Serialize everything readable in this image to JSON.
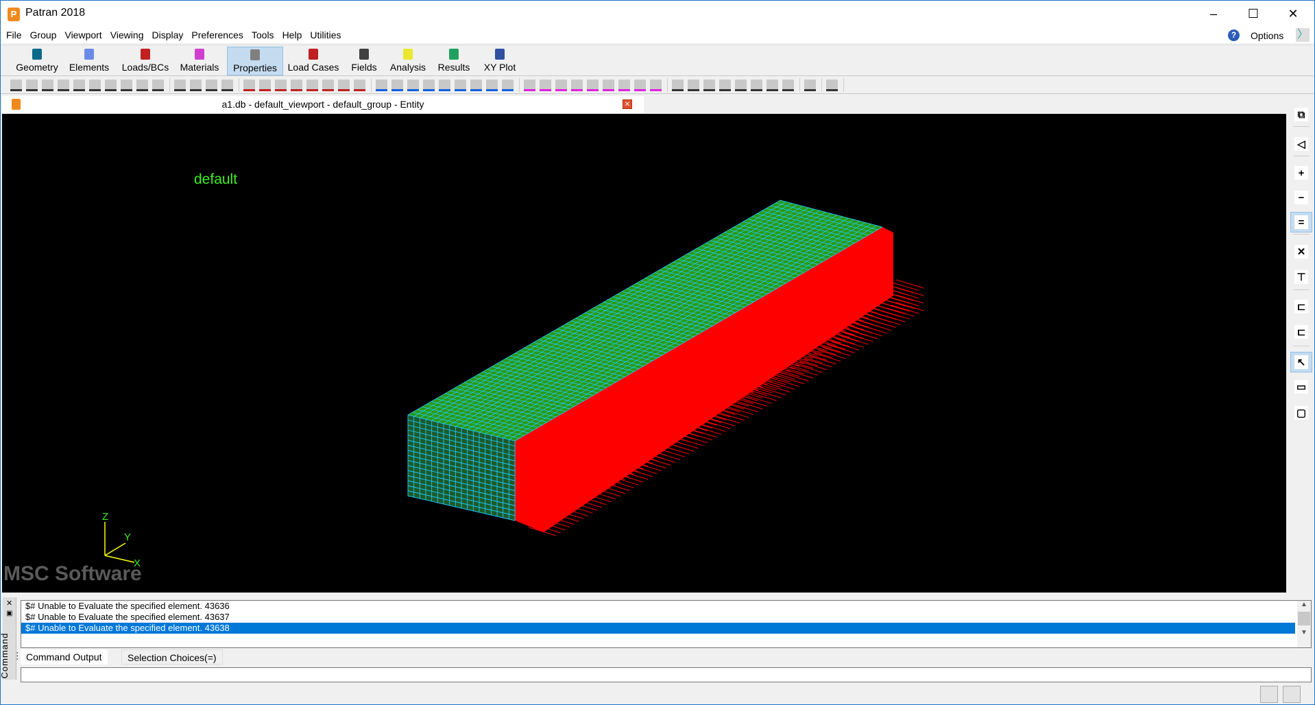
{
  "window": {
    "title": "Patran 2018",
    "minimize": "–",
    "maximize": "☐",
    "close": "✕"
  },
  "menu": [
    "File",
    "Group",
    "Viewport",
    "Viewing",
    "Display",
    "Preferences",
    "Tools",
    "Help",
    "Utilities"
  ],
  "options_label": "Options",
  "help_icon": "?",
  "app_toolbar": [
    {
      "label": "Geometry",
      "color": "#0a6a8a"
    },
    {
      "label": "Elements",
      "color": "#6a8ae8"
    },
    {
      "label": "Loads/BCs",
      "color": "#c02020"
    },
    {
      "label": "Materials",
      "color": "#d040d0"
    },
    {
      "label": "Properties",
      "color": "#808080",
      "active": true
    },
    {
      "label": "Load Cases",
      "color": "#c02020"
    },
    {
      "label": "Fields",
      "color": "#404040"
    },
    {
      "label": "Analysis",
      "color": "#e8e830"
    },
    {
      "label": "Results",
      "color": "#20a060"
    },
    {
      "label": "XY Plot",
      "color": "#3050a0"
    }
  ],
  "icon_toolbar": [
    [
      "new-file",
      "open-file",
      "open-db",
      "save",
      "print",
      "copy",
      "undo",
      "pan-hand",
      "broom",
      "spider"
    ],
    [
      "refresh-1",
      "refresh-2",
      "refresh-3",
      "refresh-4"
    ],
    [
      "fit-view",
      "move",
      "center",
      "rotate",
      "target",
      "grid-red",
      "zoom-out",
      "zoom-in"
    ],
    [
      "wireframe",
      "hidden-line",
      "shaded",
      "grid-4",
      "render-1",
      "render-2",
      "render-3",
      "triangle",
      "globe"
    ],
    [
      "view-yzx",
      "view-xzy",
      "view-zxy",
      "view-yxz",
      "view-zyx",
      "view-iso-1",
      "view-iso-2",
      "view-iso-3",
      "view-iso-4"
    ],
    [
      "pen",
      "mesh",
      "shade",
      "plot",
      "bracket",
      "node-cyan",
      "node-red",
      "table"
    ],
    [
      "home"
    ],
    [
      "tree"
    ]
  ],
  "viewport": {
    "tab_title": "a1.db - default_viewport - default_group - Entity",
    "group_label": "default",
    "axes": {
      "x": "X",
      "y": "Y",
      "z": "Z"
    },
    "watermark": "MSC Software"
  },
  "right_toolbar": [
    "window-icon",
    "lasso-icon",
    "plus-icon",
    "minus-icon",
    "equal-icon",
    "cross-tool-icon",
    "pick-filter-icon",
    "list-icon-1",
    "list-icon-2",
    "pointer-icon",
    "polygon-icon",
    "box-select-icon"
  ],
  "command": {
    "side_label": "Command ...",
    "lines": [
      "$# Unable to Evaluate the specified element. 43636",
      "$# Unable to Evaluate the specified element. 43637",
      "$# Unable to Evaluate the specified element. 43638"
    ],
    "selected_index": 2,
    "tabs": [
      "Command Output",
      "Selection Choices(=)"
    ],
    "input_value": ""
  }
}
